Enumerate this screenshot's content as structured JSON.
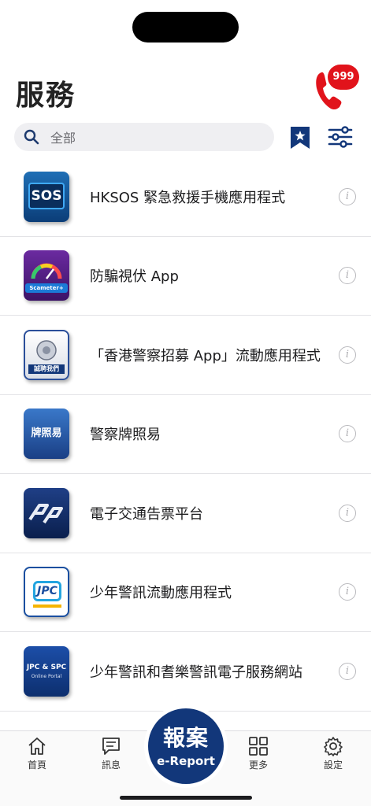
{
  "header": {
    "title": "服務",
    "call_badge": "999"
  },
  "search": {
    "placeholder": "全部"
  },
  "services": [
    {
      "label": "HKSOS 緊急救援手機應用程式",
      "icon": "hksos-app-icon",
      "icon_text": "SOS"
    },
    {
      "label": "防騙視伏 App",
      "icon": "scameter-app-icon",
      "icon_text": "Scameter+"
    },
    {
      "label": "「香港警察招募 App」流動應用程式",
      "icon": "police-recruitment-app-icon",
      "icon_text": "誠聘我們"
    },
    {
      "label": "警察牌照易",
      "icon": "police-licensing-app-icon",
      "icon_text": "牌照易"
    },
    {
      "label": "電子交通告票平台",
      "icon": "etraffic-ticket-app-icon",
      "icon_text": ""
    },
    {
      "label": "少年警訊流動應用程式",
      "icon": "jpc-app-icon",
      "icon_text": "JPC"
    },
    {
      "label": "少年警訊和耆樂警訊電子服務網站",
      "icon": "jpc-spc-portal-icon",
      "icon_text": "JPC & SPC",
      "icon_subtext": "Online Portal"
    }
  ],
  "info_glyph": "i",
  "tabbar": {
    "home": "首頁",
    "messages": "訊息",
    "report_main": "報案",
    "report_sub": "e-Report",
    "more": "更多",
    "settings": "設定"
  },
  "colors": {
    "brand_navy": "#12377a",
    "emergency_red": "#e1131b"
  }
}
